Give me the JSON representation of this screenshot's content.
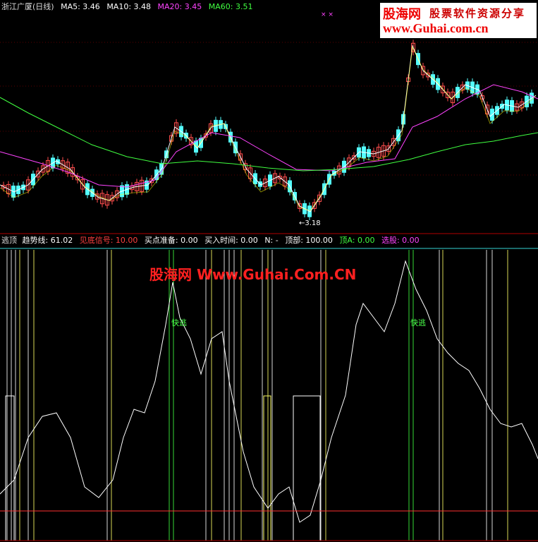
{
  "price_panel": {
    "stock_name": "浙江广厦(日线)",
    "ma5": "MA5: 3.46",
    "ma10": "MA10: 3.48",
    "ma20": "MA20: 3.45",
    "ma60": "MA60: 3.51",
    "low_marker": "3.18",
    "signal_marks": "× ×"
  },
  "indicator_panel": {
    "name": "逃顶",
    "trend": "趋势线: 61.02",
    "bottom_signal": "见底信号: 10.00",
    "buy_prepare": "买点准备: 0.00",
    "buy_time": "买入时间: 0.00",
    "n": "N: -",
    "top": "顶部: 100.00",
    "top_a": "顶A: 0.00",
    "select": "选股: 0.00",
    "fast_escape_1": "快逃",
    "fast_escape_2": "快逃"
  },
  "watermark": {
    "logo_line1": "股海网",
    "logo_line1b": "股票软件资源分享",
    "logo_line2": "www.Guhai.com.cn",
    "center": "股海网 Www.Guhai.Com.CN"
  },
  "colors": {
    "background": "#000000",
    "up": "#ff4d4d",
    "down": "#54ffff",
    "ma5": "#ffffff",
    "ma10": "#ffff00",
    "ma20": "#ff44ff",
    "ma60": "#40ff40",
    "trend": "#ffffff",
    "signal_green": "#40ff40",
    "separator": "#b00000"
  }
}
